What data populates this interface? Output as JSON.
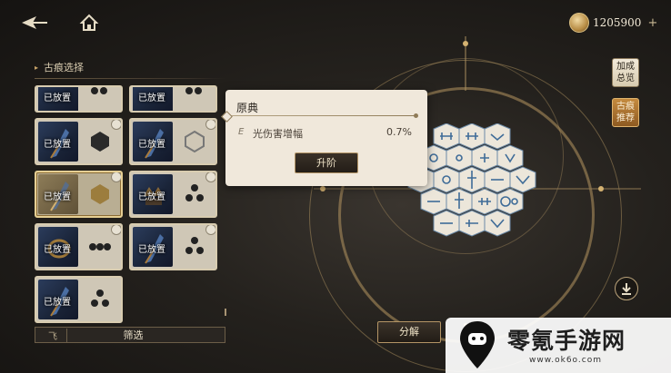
{
  "topbar": {
    "currency_amount": "1205900",
    "currency_plus": "+"
  },
  "panel": {
    "title": "古痕选择",
    "placed_label": "已放置",
    "filter_label": "筛选",
    "filter_icon_text": "飞"
  },
  "cards": [
    {
      "placed": "已放置",
      "shape": "dots2-dark"
    },
    {
      "placed": "已放置",
      "shape": "dots2-dark"
    },
    {
      "placed": "已放置",
      "shape": "hex-dark"
    },
    {
      "placed": "已放置",
      "shape": "hex-light"
    },
    {
      "placed": "已放置",
      "shape": "hex-gold",
      "selected": true
    },
    {
      "placed": "已放置",
      "shape": "triangle-dots"
    },
    {
      "placed": "已放置",
      "shape": "three-dots-row"
    },
    {
      "placed": "已放置",
      "shape": "triangle-dots"
    },
    {
      "placed": "已放置",
      "shape": "triangle-dots"
    }
  ],
  "popup": {
    "title": "原典",
    "stat_name": "光伤害增幅",
    "stat_value": "0.7%",
    "upgrade_label": "升阶"
  },
  "side_buttons": {
    "bonus_overview": "加成总览",
    "recommend": "古痕推荐"
  },
  "decompose_label": "分解",
  "watermark": {
    "text": "零氪手游网",
    "url": "www.ok6o.com"
  },
  "colors": {
    "accent_gold": "#b49566",
    "active_orange": "#c58b3f"
  }
}
